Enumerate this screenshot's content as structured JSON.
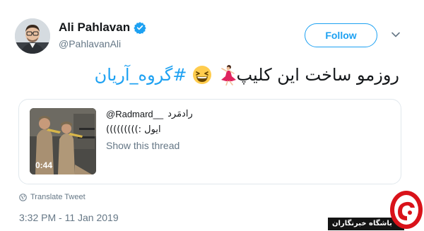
{
  "author": {
    "display_name": "Ali Pahlavan",
    "handle": "@PahlavanAli"
  },
  "follow_label": "Follow",
  "tweet": {
    "text": "روزمو ساخت این کلیپ",
    "hashtag": "#گروه_آریان",
    "emoji": [
      "dancer-emoji",
      "grinning-squinting-face-emoji"
    ]
  },
  "quote": {
    "handle": "@Radmard__",
    "name": "رادمَرد",
    "text": "ایول :)))))))))",
    "show_thread": "Show this thread",
    "video_duration": "0:44"
  },
  "translate_label": "Translate Tweet",
  "timestamp": "3:32 PM - 11 Jan 2019",
  "watermark": {
    "text": "باشگاه خبرنگاران"
  },
  "colors": {
    "accent": "#1da1f2",
    "secondary_text": "#657786",
    "border": "#e1e8ed",
    "watermark_red": "#d9121a"
  }
}
